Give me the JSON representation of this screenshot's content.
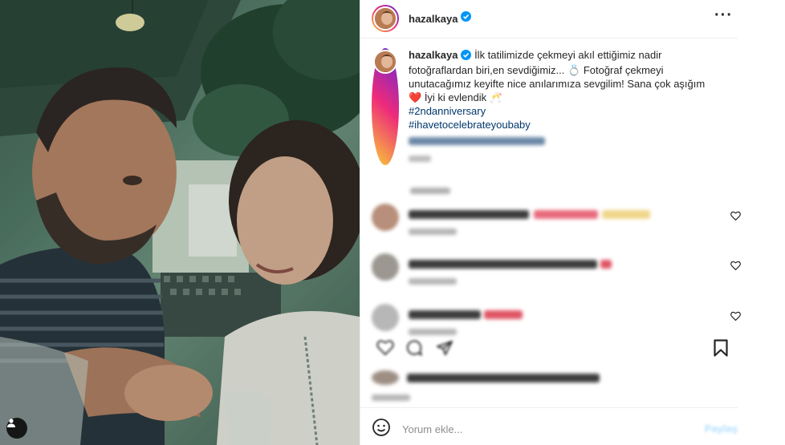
{
  "post": {
    "username": "hazalkaya",
    "verified": true,
    "more_icon": "more-options-icon",
    "photo_description_icon": "user-tag-icon"
  },
  "caption": {
    "username": "hazalkaya",
    "line1": "İlk tatilimizde çekmeyi akıl ettiğimiz nadir fotoğraflardan biri,en sevdiğimiz...",
    "emoji1": "💍",
    "line2": "Fotoğraf çekmeyi unutacağımız keyifte nice anılarımıza sevgilim! Sana çok aşığım",
    "emoji2": "❤️",
    "line3": "İyi ki evlendik",
    "emoji3": "🥂",
    "hashtags": [
      "#2ndanniversary",
      "#ihavetocelebrateyoubaby"
    ]
  },
  "comments": [
    {
      "id": 1,
      "like_icon": "heart-outline-icon"
    },
    {
      "id": 2,
      "like_icon": "heart-outline-icon"
    },
    {
      "id": 3,
      "like_icon": "heart-outline-icon"
    }
  ],
  "actions": {
    "like_icon": "heart-outline-icon",
    "comment_icon": "comment-bubble-icon",
    "share_icon": "paper-plane-icon",
    "save_icon": "bookmark-icon"
  },
  "add_comment": {
    "emoji_icon": "emoji-smile-icon",
    "placeholder": "Yorum ekle...",
    "post_label": "Paylaş"
  },
  "colors": {
    "text": "#262626",
    "hashtag": "#00376b",
    "verified": "#0095f6",
    "secondary": "#8e8e8e",
    "heart_red": "#ed4956"
  }
}
